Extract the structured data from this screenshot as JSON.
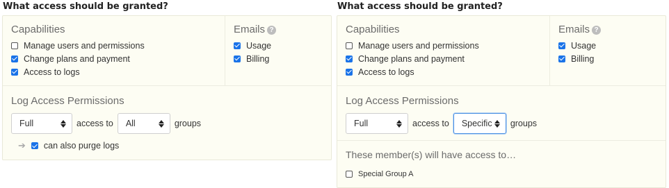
{
  "left": {
    "heading": "What access should be granted?",
    "capabilities": {
      "title": "Capabilities",
      "items": [
        {
          "label": "Manage users and permissions",
          "checked": false
        },
        {
          "label": "Change plans and payment",
          "checked": true
        },
        {
          "label": "Access to logs",
          "checked": true
        }
      ]
    },
    "emails": {
      "title": "Emails",
      "help_icon": "?",
      "items": [
        {
          "label": "Usage",
          "checked": true
        },
        {
          "label": "Billing",
          "checked": true
        }
      ]
    },
    "log_access": {
      "title": "Log Access Permissions",
      "level_value": "Full",
      "access_to_text": "access to",
      "groups_value": "All",
      "groups_text": "groups",
      "purge_label": "can also purge logs",
      "purge_checked": true
    }
  },
  "right": {
    "heading": "What access should be granted?",
    "capabilities": {
      "title": "Capabilities",
      "items": [
        {
          "label": "Manage users and permissions",
          "checked": false
        },
        {
          "label": "Change plans and payment",
          "checked": true
        },
        {
          "label": "Access to logs",
          "checked": true
        }
      ]
    },
    "emails": {
      "title": "Emails",
      "help_icon": "?",
      "items": [
        {
          "label": "Usage",
          "checked": true
        },
        {
          "label": "Billing",
          "checked": true
        }
      ]
    },
    "log_access": {
      "title": "Log Access Permissions",
      "level_value": "Full",
      "access_to_text": "access to",
      "groups_value": "Specific",
      "groups_text": "groups"
    },
    "members": {
      "title": "These member(s) will have access to…",
      "items": [
        {
          "label": "Special Group A",
          "checked": false
        }
      ]
    }
  },
  "colors": {
    "accent": "#1a73e8",
    "panel_bg": "#fdfdf3",
    "panel_border": "#e9e9d8",
    "focus_border": "#4a90e2"
  },
  "icons": {
    "help": "question-circle-icon",
    "select_caret": "up-down-caret-icon",
    "indent_arrow": "arrow-right-icon",
    "checkmark": "checkmark-icon"
  }
}
